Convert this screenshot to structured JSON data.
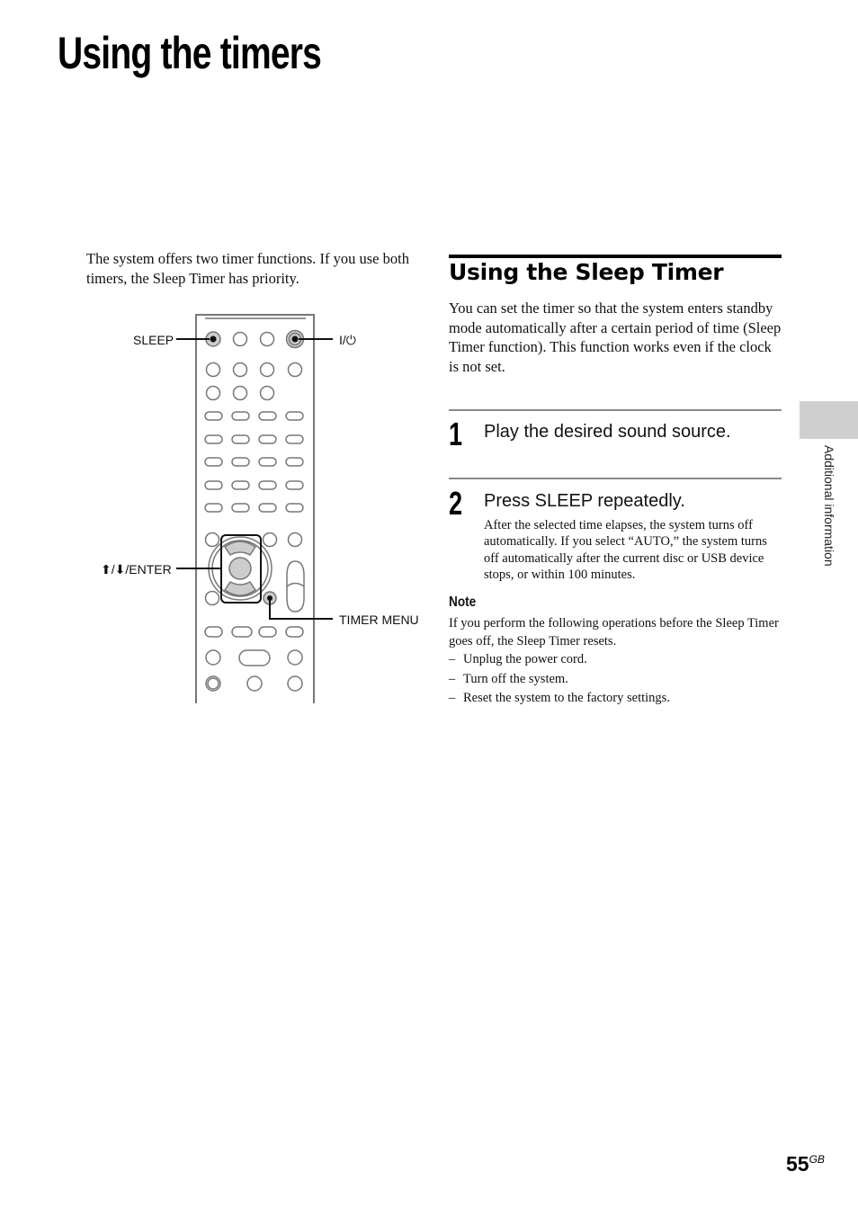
{
  "page": {
    "title": "Using the timers",
    "intro": "The system offers two timer functions. If you use both timers, the Sleep Timer has priority.",
    "side_tab_label": "Additional information",
    "page_number": "55",
    "page_suffix": "GB"
  },
  "diagram": {
    "labels": {
      "sleep": "SLEEP",
      "power": "I/⏻",
      "enter": "⬆/⬇/ENTER",
      "timer_menu": "TIMER MENU"
    },
    "icons": [
      "remote-control",
      "sleep-button",
      "power-button",
      "arrow-enter-pad",
      "timer-menu-button"
    ]
  },
  "section": {
    "heading": "Using the Sleep Timer",
    "body": "You can set the timer so that the system enters standby mode automatically after a certain period of time (Sleep Timer function). This function works even if the clock is not set.",
    "steps": [
      {
        "number": "1",
        "title": "Play the desired sound source."
      },
      {
        "number": "2",
        "title": "Press SLEEP repeatedly.",
        "description": "After the selected time elapses, the system turns off automatically. If you select “AUTO,” the system turns off automatically after the current disc or USB device stops, or within 100 minutes."
      }
    ],
    "note": {
      "title": "Note",
      "body": "If you perform the following operations before the Sleep Timer goes off, the Sleep Timer resets.",
      "dash": "–",
      "items": [
        "Unplug the power cord.",
        "Turn off the system.",
        "Reset the system to the factory settings."
      ]
    }
  }
}
